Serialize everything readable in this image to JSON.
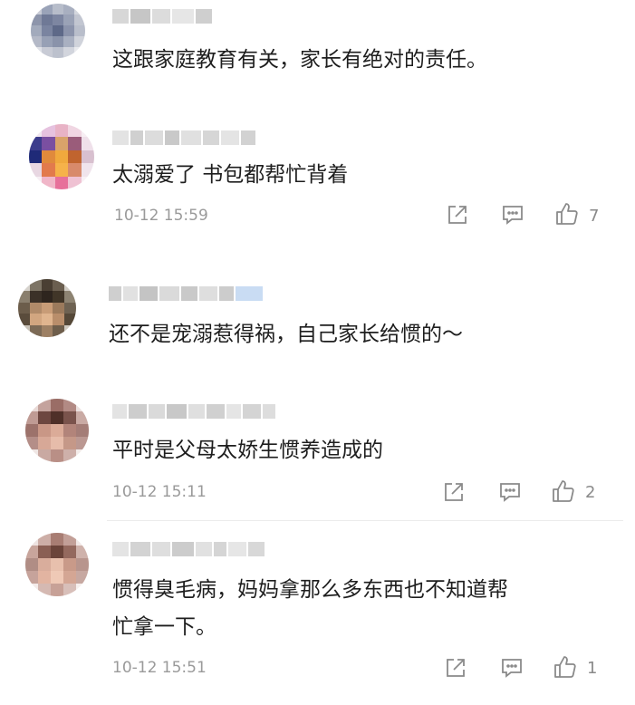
{
  "comments": [
    {
      "text": "这跟家庭教育有关，家长有绝对的责任。"
    },
    {
      "text": "太溺爱了 书包都帮忙背着",
      "time": "10-12 15:59",
      "likes": "7"
    },
    {
      "text": "还不是宠溺惹得祸，自己家长给惯的～"
    },
    {
      "text": "平时是父母太娇生惯养造成的",
      "time": "10-12 15:11",
      "likes": "2"
    },
    {
      "text_line1": "惯得臭毛病，妈妈拿那么多东西也不知道帮",
      "text_line2": "忙拿一下。",
      "time": "10-12 15:51",
      "likes": "1"
    }
  ],
  "icons": {
    "share": "share-icon",
    "reply": "reply-icon",
    "like": "thumbs-up-icon"
  },
  "colors": {
    "text": "#1e1e1e",
    "meta": "#9a9a9a",
    "icon": "#8a8a8a"
  }
}
